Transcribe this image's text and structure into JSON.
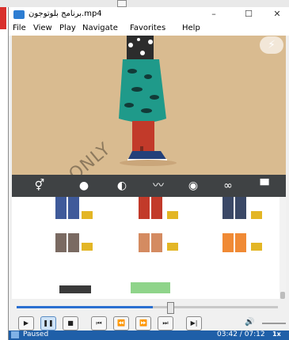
{
  "window": {
    "title": "برنامج بلوتوجون.mp4"
  },
  "window_buttons": {
    "minimize": "–",
    "maximize": "☐",
    "close": "✕"
  },
  "menu": [
    "File",
    "View",
    "Play",
    "Navigate",
    "Favorites",
    "Help"
  ],
  "video": {
    "watermark": "USE ONLY",
    "flash_button_icon": "lightning-icon",
    "toolbar_icons": [
      "gender-icon",
      "head-icon",
      "hair-icon",
      "mustache-icon",
      "eye-icon",
      "glasses-icon",
      "shirt-icon"
    ]
  },
  "playback": {
    "progress": 0.52,
    "controls": [
      "play",
      "pause",
      "stop",
      "previous",
      "rewind",
      "fast-forward",
      "next",
      "frame-step"
    ],
    "status": "Paused",
    "time": "03:42 / 07:12",
    "speed": "1x"
  },
  "colors": {
    "status_bar": "#1f5fa8",
    "video_bg": "#d9bb90",
    "toolbar": "#3f4244"
  }
}
